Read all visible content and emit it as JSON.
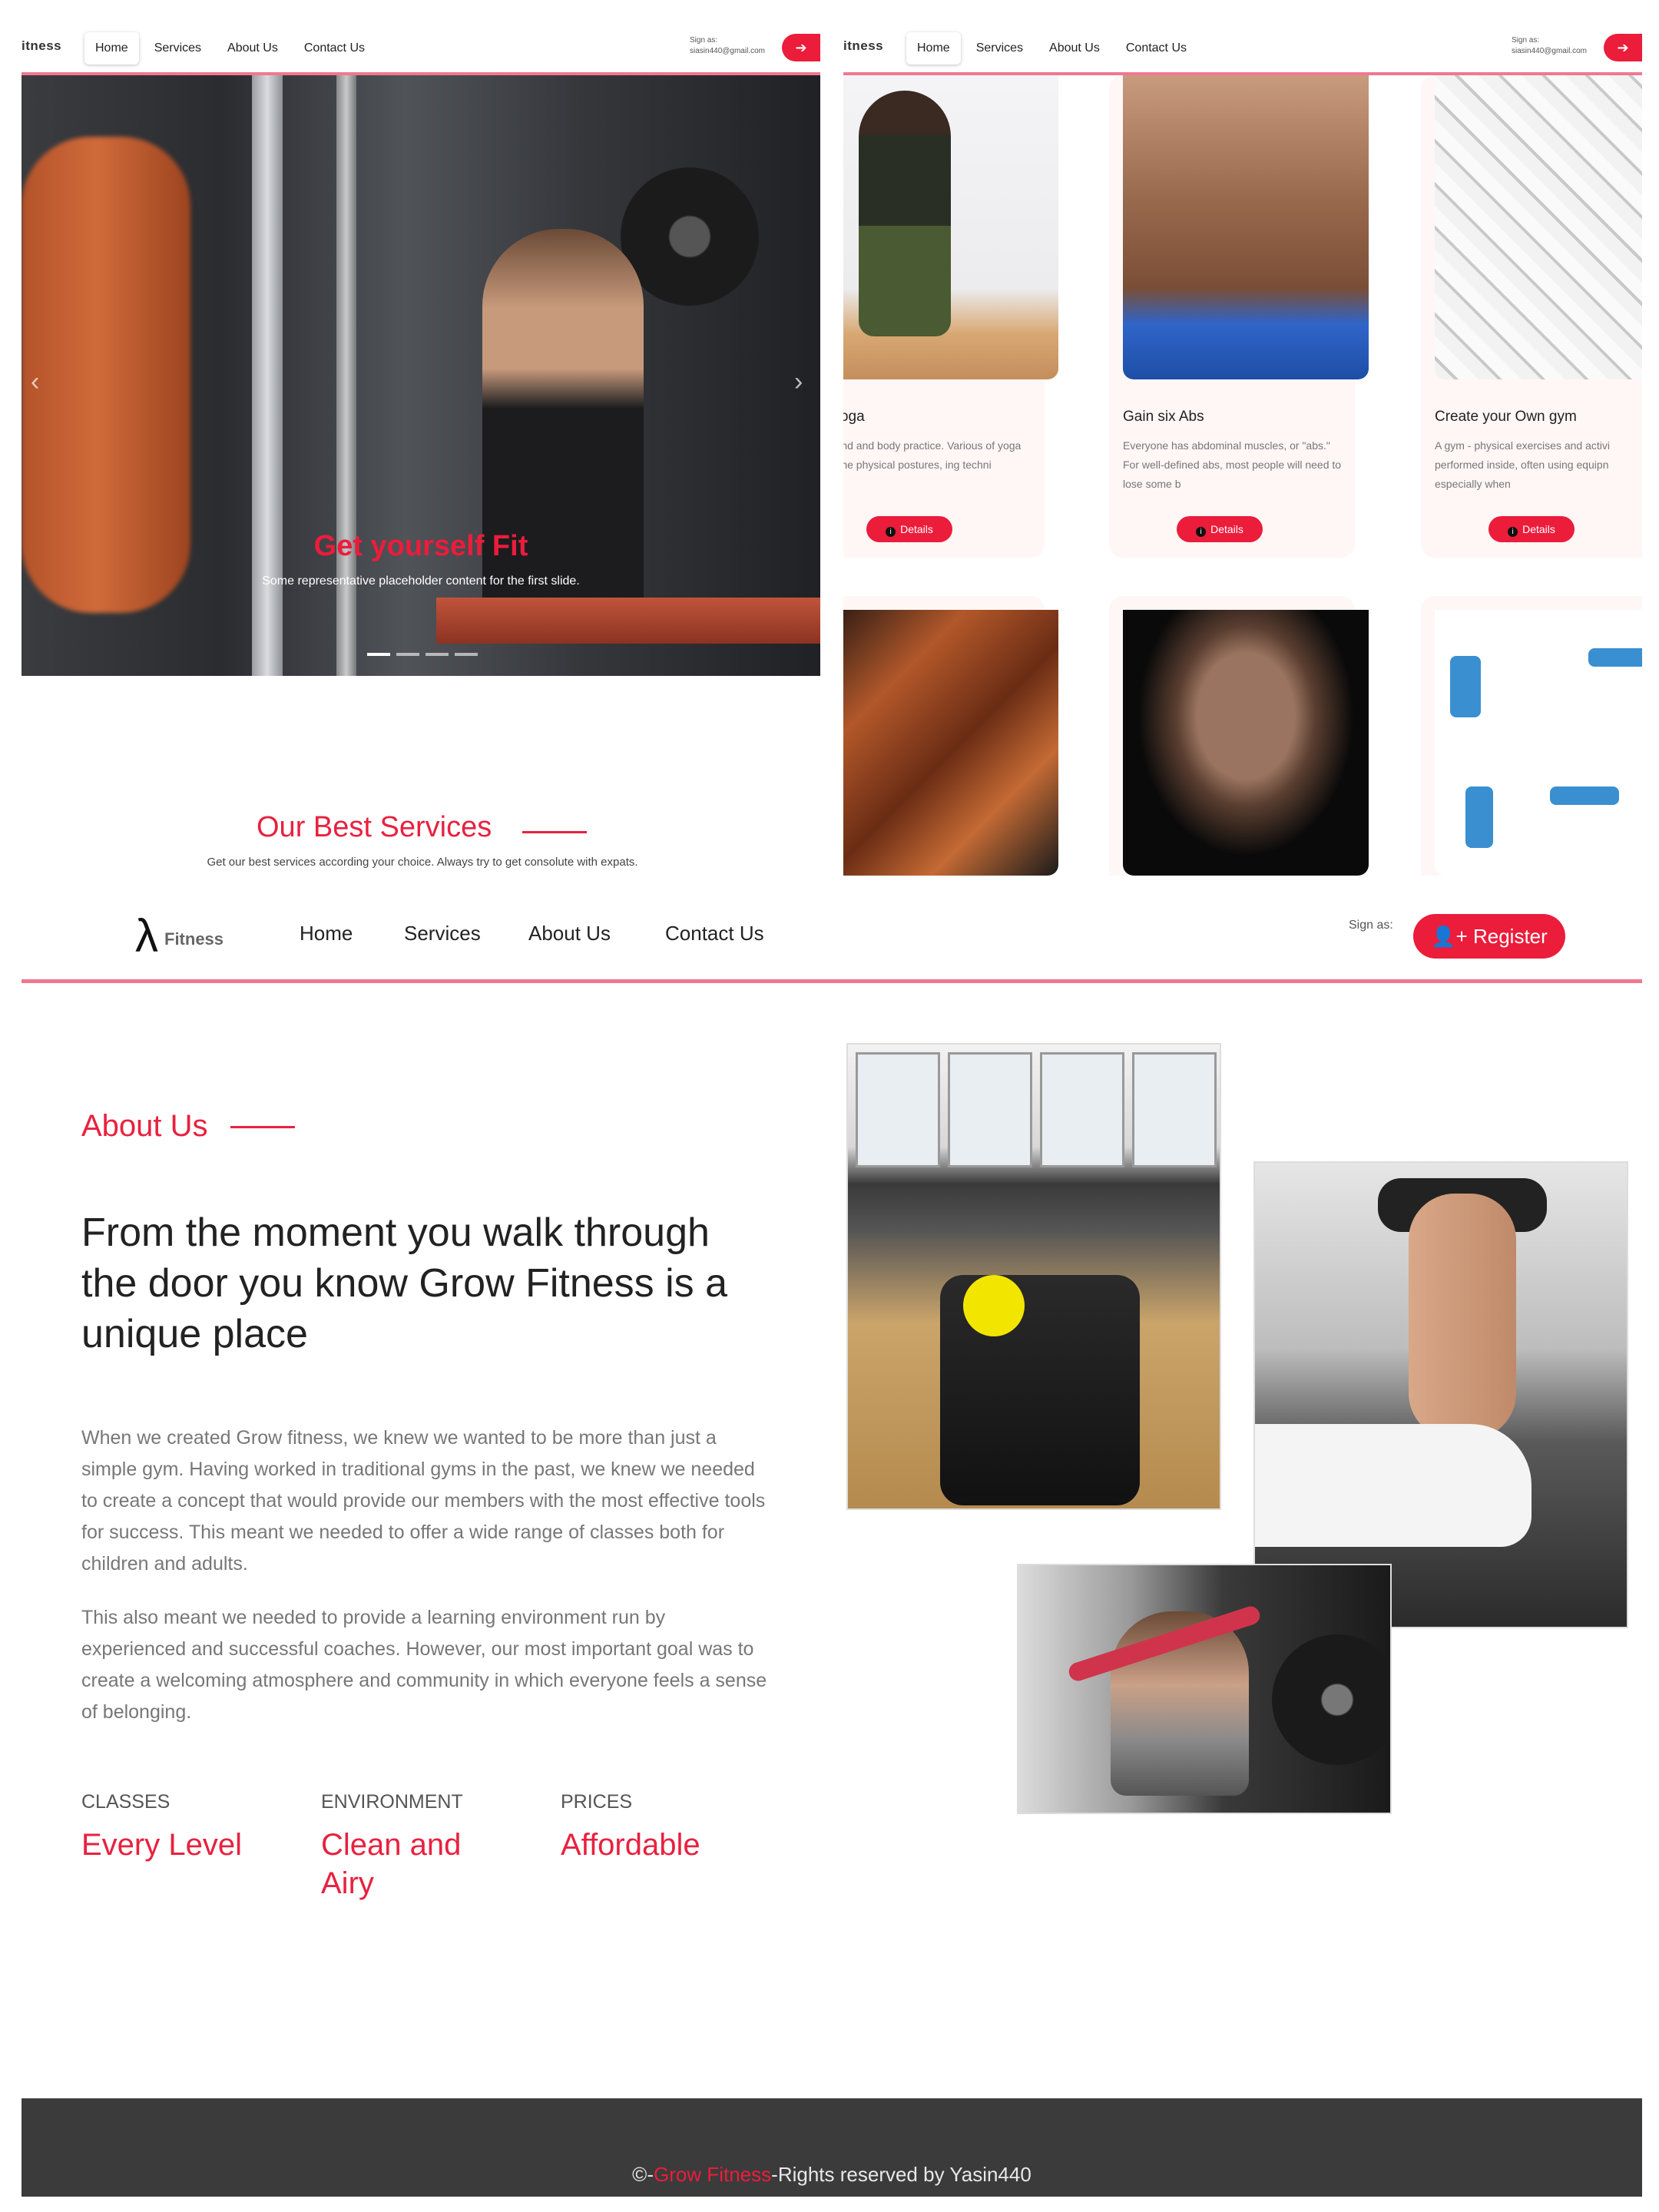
{
  "thumb_nav": {
    "brand": "itness",
    "links": [
      "Home",
      "Services",
      "About Us",
      "Contact Us"
    ],
    "sign_as_label": "Sign as:",
    "sign_as_email": "siasin440@gmail.com",
    "register_icon": "sign-in-icon"
  },
  "hero": {
    "caption_title": "Get yourself Fit",
    "caption_text": "Some representative placeholder content for the first slide.",
    "prev_icon": "‹",
    "next_icon": "›",
    "indicator_count": 4,
    "active_indicator": 0
  },
  "services_section": {
    "heading": "Our Best Services",
    "subheading": "Get our best services according your choice. Always try to get consolute with expats."
  },
  "services_cards": [
    {
      "title": "ith Yoga",
      "desc": "s a mind and body practice. Various of yoga combine physical postures, ing techni",
      "button": "Details",
      "image": "yoga-photo"
    },
    {
      "title": "Gain six Abs",
      "desc": "Everyone has abdominal muscles, or \"abs.\" For well-defined abs, most people will need to lose some b",
      "button": "Details",
      "image": "abs-photo"
    },
    {
      "title": "Create your Own gym",
      "desc": "A gym - physical exercises and activi performed inside, often using equipn especially when",
      "button": "Details",
      "image": "gym-equipment-photo"
    }
  ],
  "services_cards_row2": [
    "bodybuilders-photo",
    "bodybuilder-photo",
    "exercises-illustration"
  ],
  "main_nav": {
    "brand": "Fitness",
    "links": [
      "Home",
      "Services",
      "About Us",
      "Contact Us"
    ],
    "sign_as_label": "Sign as:",
    "register_label": "Register",
    "register_icon": "user-plus-icon"
  },
  "about": {
    "label": "About Us",
    "headline": "From the moment you walk through the door you know Grow Fitness is a unique place",
    "paragraph1": "When we created Grow fitness, we knew we wanted to be more than just a simple gym. Having worked in traditional gyms in the past, we knew we needed to create a concept that would provide our members with the most effective tools for success. This meant we needed to offer a wide range of classes both for children and adults.",
    "paragraph2": "This also meant we needed to provide a learning environment run by experienced and successful coaches. However, our most important goal was to create a welcoming atmosphere and community in which everyone feels a sense of belonging.",
    "stats": [
      {
        "label": "CLASSES",
        "value": "Every Level"
      },
      {
        "label": "ENVIRONMENT",
        "value": "Clean and Airy"
      },
      {
        "label": "PRICES",
        "value": "Affordable"
      }
    ],
    "photos": [
      "gym-bike-photo",
      "dumbbell-press-photo",
      "lat-pulldown-photo"
    ]
  },
  "footer": {
    "prefix": "©-",
    "brand": "Grow Fitness",
    "suffix": "-Rights reserved by Yasin440"
  },
  "colors": {
    "accent": "#ec1c3b",
    "nav_border": "#f07890",
    "footer_bg": "#3b3b3b"
  }
}
